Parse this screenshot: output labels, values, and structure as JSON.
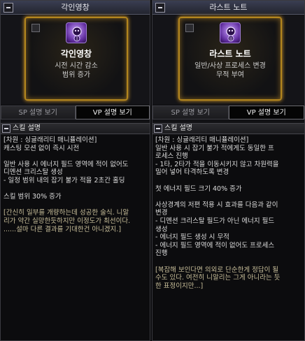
{
  "left": {
    "title": "각인영창",
    "card": {
      "name": "각인영창",
      "desc1": "시전 시간 감소",
      "desc2": "범위 증가",
      "rank": "I"
    },
    "tabs": {
      "sp": "SP 설명 보기",
      "vp": "VP 설명 보기"
    },
    "section_label": "스킬 설명",
    "lines": [
      "[차원 : 싱귤래리티 매니퓰레이션]",
      "캐스팅 모션 없이 즉시 시전",
      "",
      "일반 사용 시 에너지 필드 영역에 적이 없어도",
      "디멘션 크리스탈 생성",
      "- 일정 범위 내의 잡기 불가 적을 2초간 홀딩",
      "",
      "스킬 범위 30% 증가",
      "",
      "[간신히 일부를 개량하는데 성공한 술식. 니알",
      "리가 약간 실망한듯하지만 이정도가 최선이다.",
      "......설마 다른 결과를 기대한건 아니겠지.]"
    ]
  },
  "right": {
    "title": "라스트 노트",
    "card": {
      "name": "라스트 노트",
      "desc1": "일반/사상 프로세스 변경",
      "desc2": "무적 부여",
      "rank": "II"
    },
    "tabs": {
      "sp": "SP 설명 보기",
      "vp": "VP 설명 보기"
    },
    "section_label": "스킬 설명",
    "lines": [
      "[차원 : 싱귤래리티 매니퓰레이션]",
      "일반 사용 시 잡기 불가 적에게도 동일한 프",
      "로세스 진행",
      "- 1타, 2타가 적을 이동시키지 않고 차원력을",
      "밀어 넣어 타격하도록 변경",
      "",
      "첫 에너지 필드 크기 40% 증가",
      "",
      "사상경계의 저편 적용 시 효과를 다음과 같이",
      "변경",
      "- 디멘션 크리스탈 필드가 아닌 에너지 필드",
      "생성",
      "- 에너지 필드 생성 시 무적",
      "- 에너지 필드 영역에 적이 없어도 프로세스",
      "진행",
      "",
      "[복잡해 보인다면 의외로 단순한게 정답이 될",
      "수도 있다. 여전히 니알리는 그게 아니라는 듯",
      "한 표정이지만...]"
    ]
  }
}
